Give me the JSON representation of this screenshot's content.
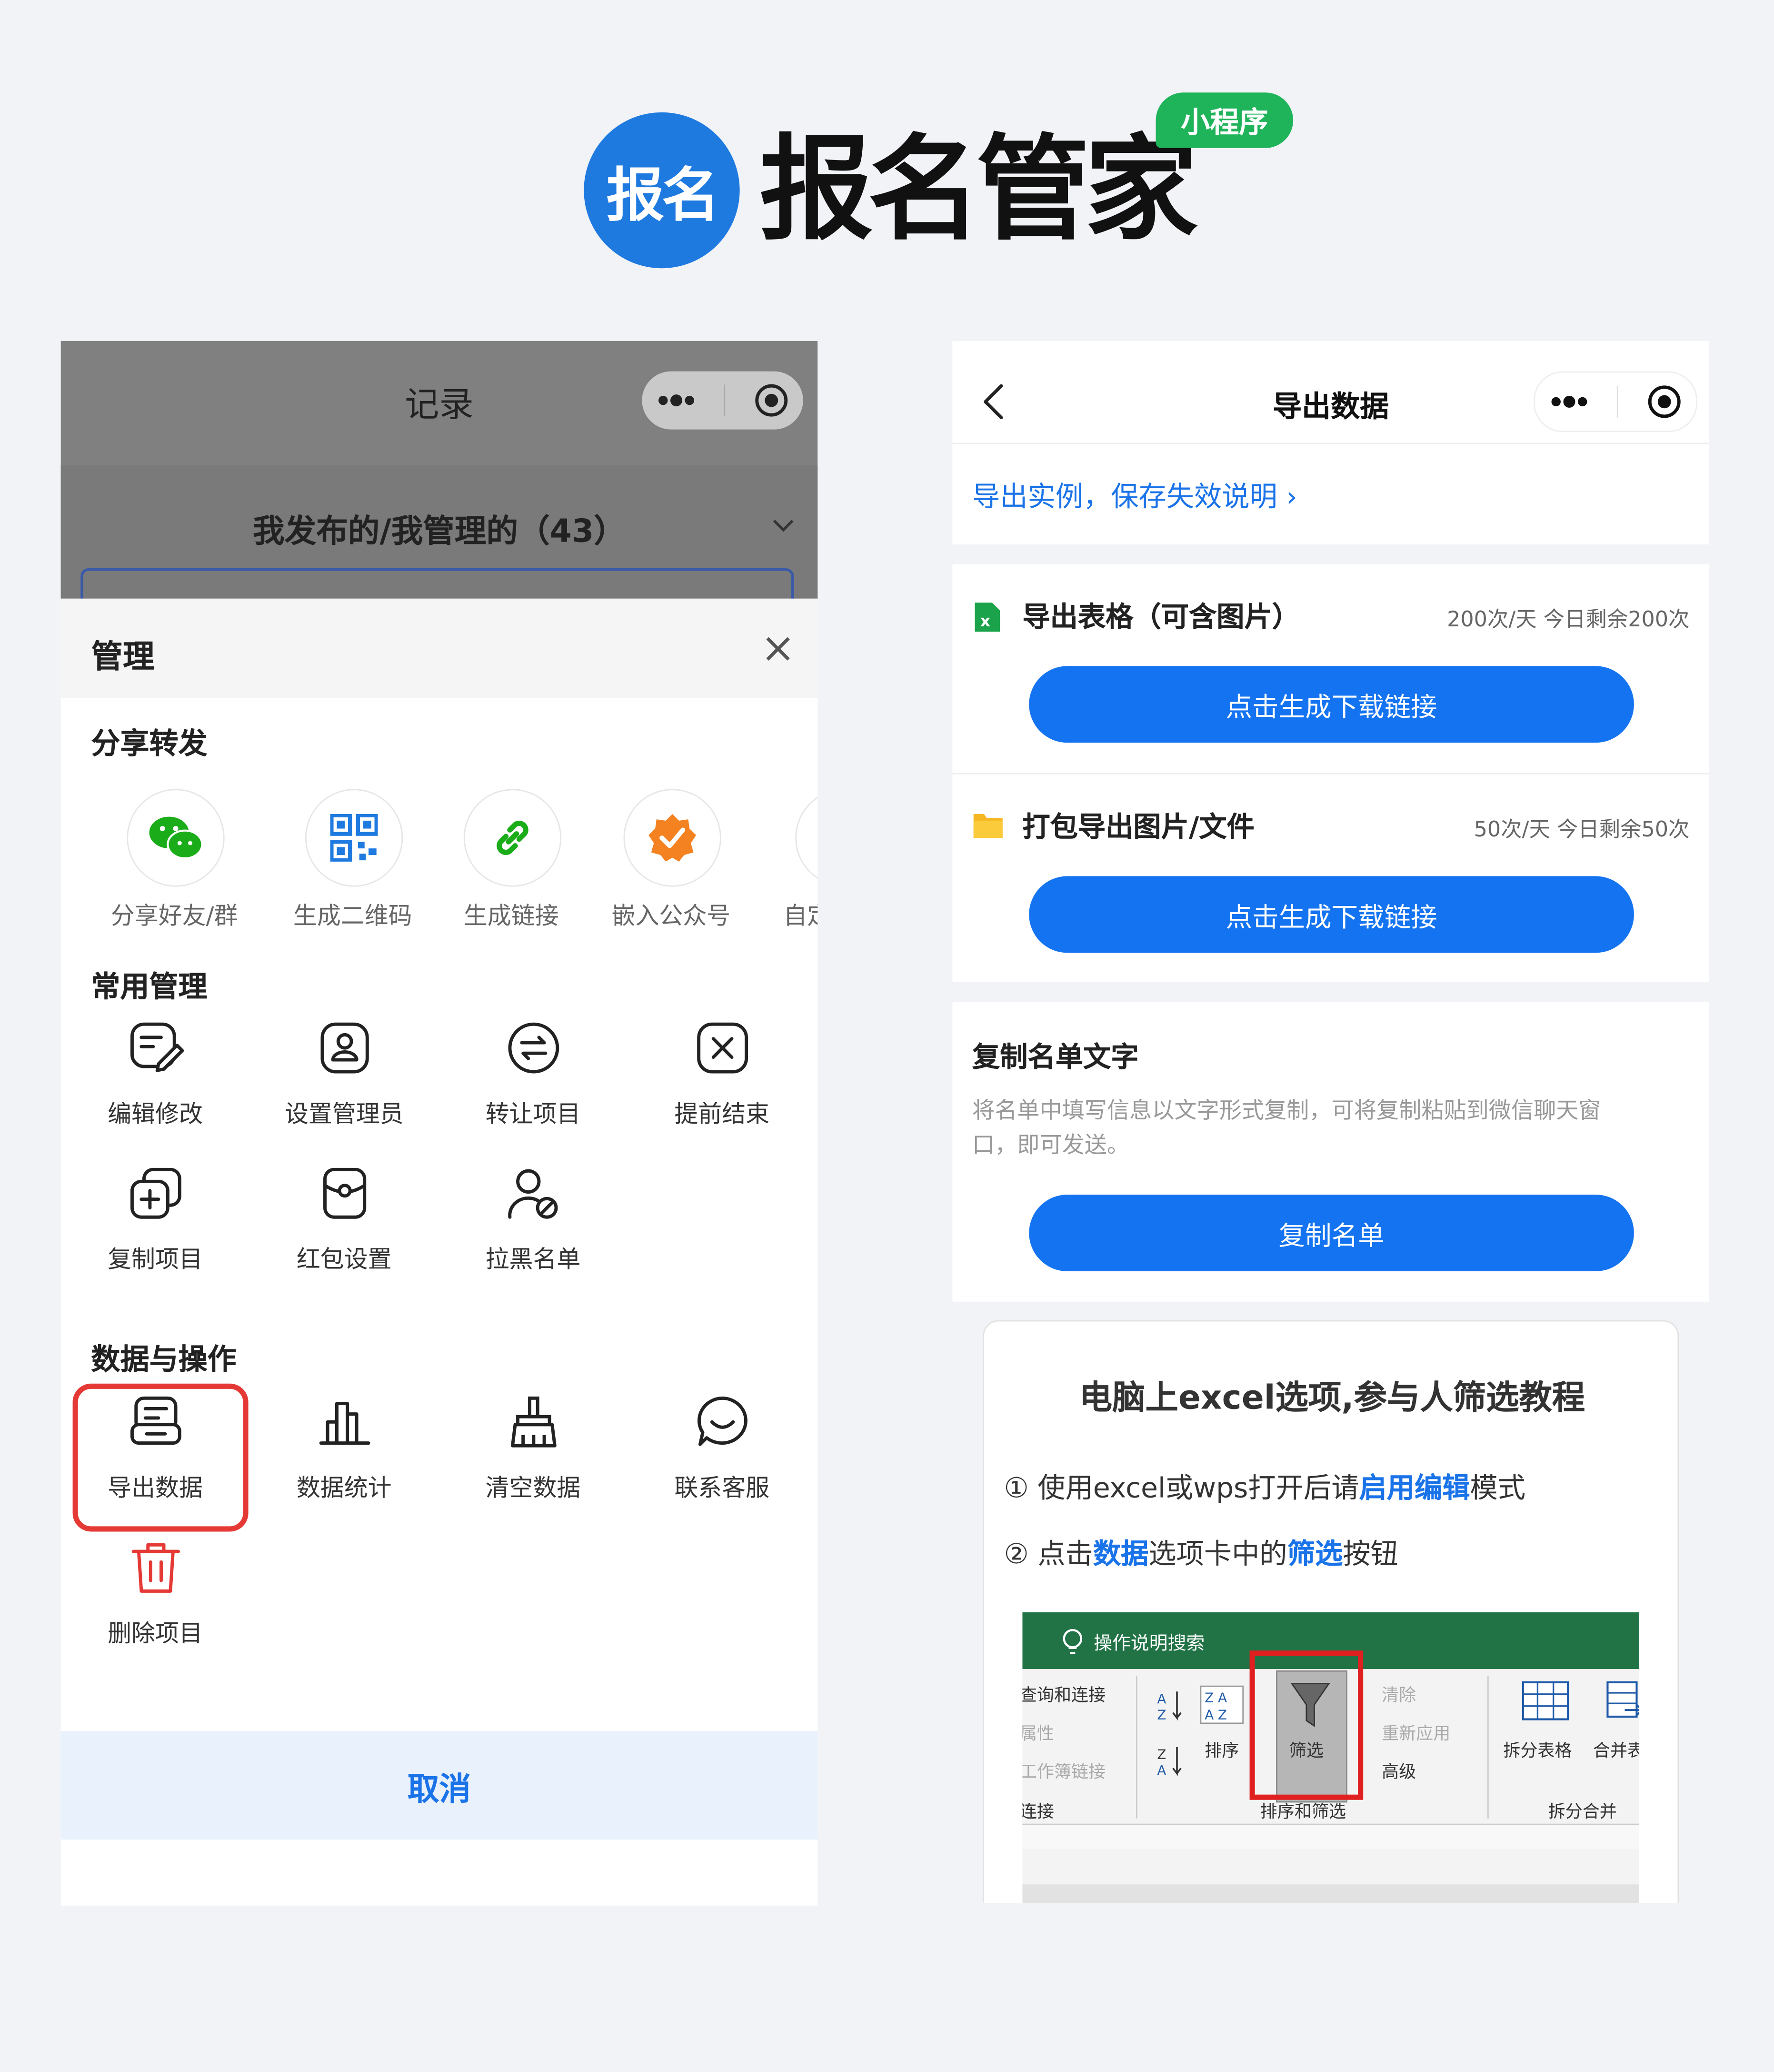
{
  "header": {
    "logo_text": "报名",
    "brand_name": "报名管家",
    "badge": "小程序"
  },
  "left_phone": {
    "title": "记录",
    "subtitle": "我发布的/我管理的（43）",
    "sheet_title": "管理",
    "sections": {
      "share": {
        "title": "分享转发",
        "items": [
          {
            "label": "分享好友/群",
            "icon": "wechat-icon"
          },
          {
            "label": "生成二维码",
            "icon": "qrcode-icon"
          },
          {
            "label": "生成链接",
            "icon": "link-icon"
          },
          {
            "label": "嵌入公众号",
            "icon": "verified-badge-icon"
          },
          {
            "label": "自定",
            "icon": "custom-icon"
          }
        ]
      },
      "common": {
        "title": "常用管理",
        "items": [
          {
            "label": "编辑修改",
            "icon": "edit-icon"
          },
          {
            "label": "设置管理员",
            "icon": "admin-icon"
          },
          {
            "label": "转让项目",
            "icon": "transfer-icon"
          },
          {
            "label": "提前结束",
            "icon": "end-icon"
          },
          {
            "label": "复制项目",
            "icon": "copy-icon"
          },
          {
            "label": "红包设置",
            "icon": "red-packet-icon"
          },
          {
            "label": "拉黑名单",
            "icon": "blacklist-icon"
          }
        ]
      },
      "data_ops": {
        "title": "数据与操作",
        "items": [
          {
            "label": "导出数据",
            "icon": "export-icon",
            "highlighted": true
          },
          {
            "label": "数据统计",
            "icon": "stats-icon"
          },
          {
            "label": "清空数据",
            "icon": "broom-icon"
          },
          {
            "label": "联系客服",
            "icon": "chat-icon"
          },
          {
            "label": "删除项目",
            "icon": "trash-icon"
          }
        ]
      }
    },
    "cancel_label": "取消"
  },
  "right_phone": {
    "title": "导出数据",
    "tip_link": "导出实例，保存失效说明",
    "export_rows": [
      {
        "title": "导出表格（可含图片）",
        "quota": "200次/天  今日剩余200次",
        "button": "点击生成下载链接",
        "icon": "excel-icon"
      },
      {
        "title": "打包导出图片/文件",
        "quota": "50次/天  今日剩余50次",
        "button": "点击生成下载链接",
        "icon": "folder-icon"
      }
    ],
    "copy_section": {
      "title": "复制名单文字",
      "desc_line1": "将名单中填写信息以文字形式复制，可将复制粘贴到微信聊天窗",
      "desc_line2": "口，即可发送。",
      "button": "复制名单"
    },
    "tutorial": {
      "title": "电脑上excel选项,参与人筛选教程",
      "step1": {
        "prefix": "① 使用excel或wps打开后请",
        "highlight": "启用编辑",
        "suffix": "模式"
      },
      "step2": {
        "prefix": "② 点击",
        "hl1": "数据",
        "mid": "选项卡中的",
        "hl2": "筛选",
        "suffix": "按钮"
      },
      "ribbon": {
        "search": "操作说明搜索",
        "left_items": [
          "查询和连接",
          "属性",
          "工作簿链接",
          "连接"
        ],
        "sort_label": "排序",
        "filter_label": "筛选",
        "clear": "清除",
        "reapply": "重新应用",
        "advanced": "高级",
        "group_label": "排序和筛选",
        "split_table": "拆分表格",
        "merge": "合并表",
        "split_group": "拆分合并"
      }
    }
  },
  "colors": {
    "brand_blue": "#1f7ae0",
    "button_blue": "#1473f0",
    "badge_green": "#1fb35a",
    "highlight_red": "#e53935",
    "excel_green": "#217346"
  }
}
